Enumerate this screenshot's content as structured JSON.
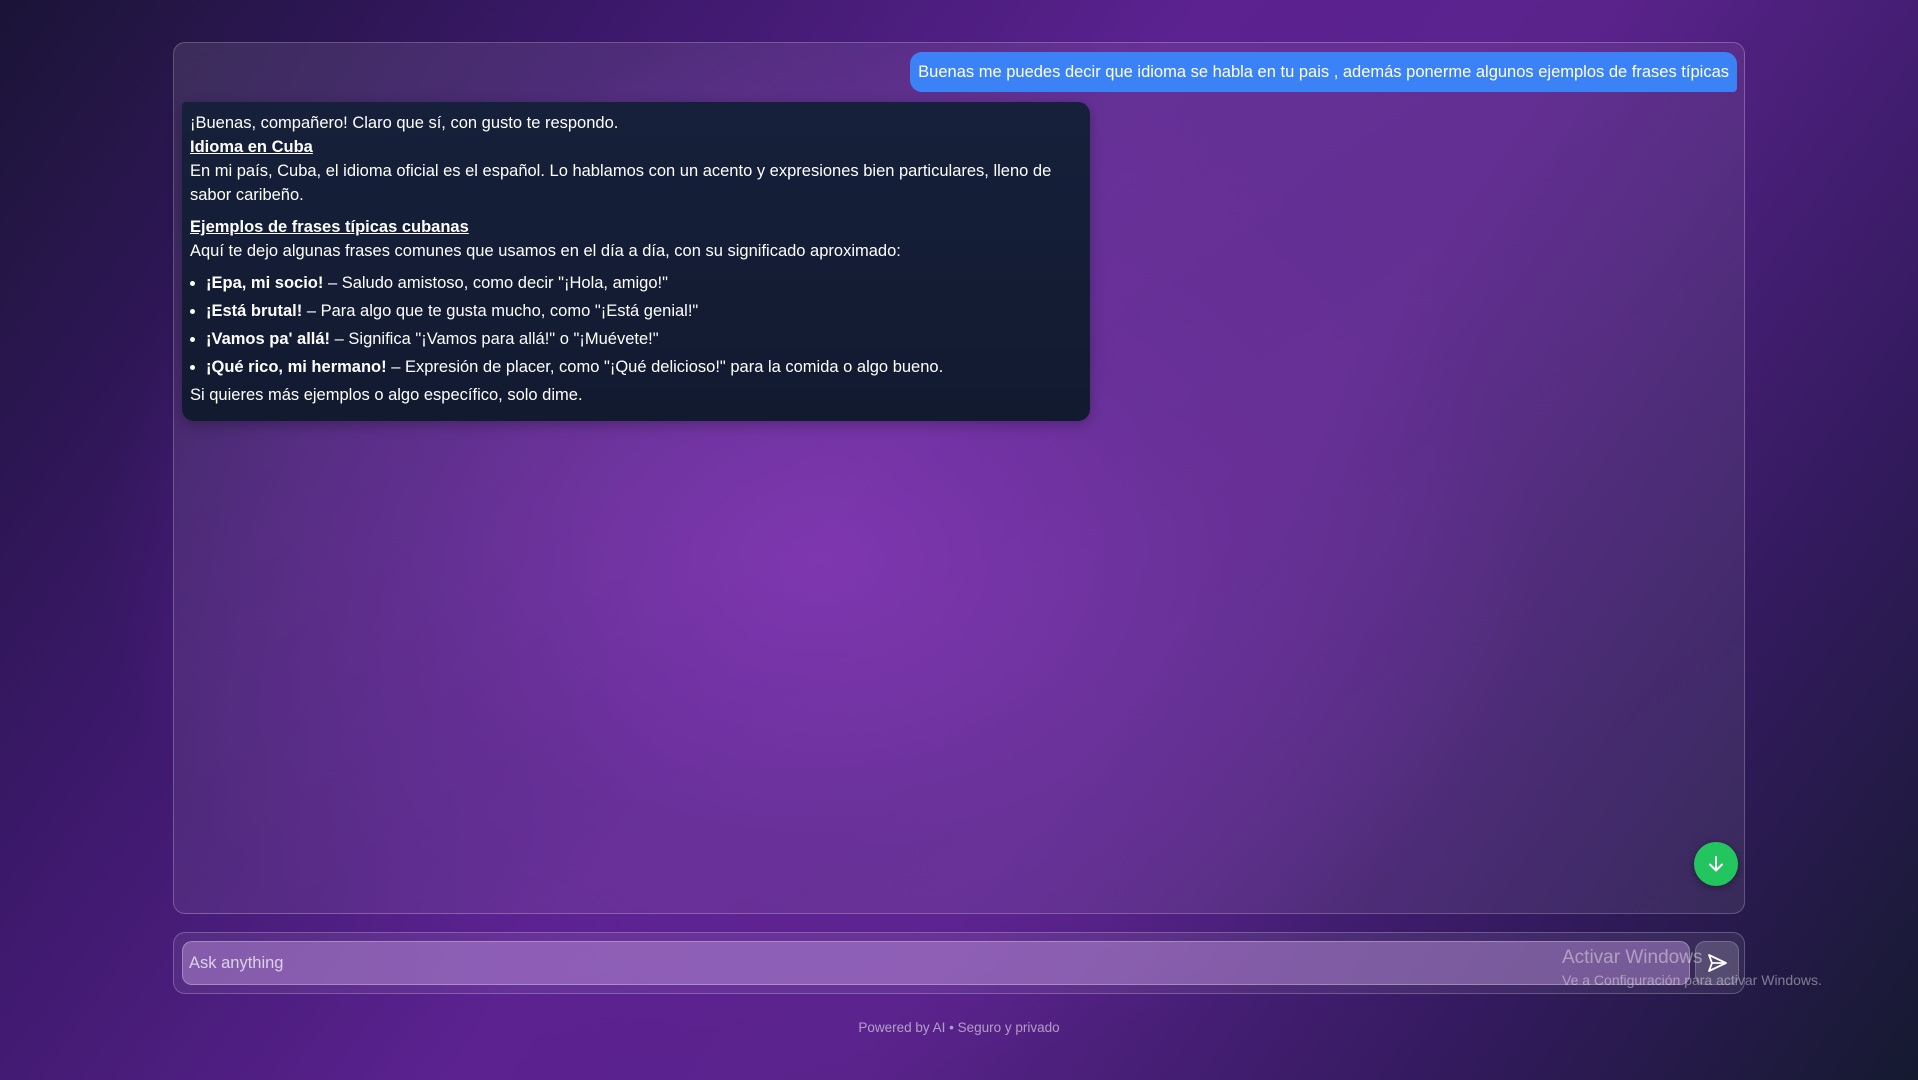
{
  "conversation": {
    "user_message": "Buenas me puedes decir que idioma se habla en tu pais , además ponerme algunos ejemplos de frases típicas",
    "assistant": {
      "greeting": "¡Buenas, compañero! Claro que sí, con gusto te respondo.",
      "heading_language": "Idioma en Cuba",
      "language_text": "En mi país, Cuba, el idioma oficial es el español. Lo hablamos con un acento y expresiones bien particulares, lleno de sabor caribeño.",
      "heading_phrases": "Ejemplos de frases típicas cubanas",
      "phrases_intro": "Aquí te dejo algunas frases comunes que usamos en el día a día, con su significado aproximado:",
      "phrases": [
        {
          "phrase": "¡Epa, mi socio!",
          "meaning": " – Saludo amistoso, como decir \"¡Hola, amigo!\""
        },
        {
          "phrase": "¡Está brutal!",
          "meaning": " – Para algo que te gusta mucho, como \"¡Está genial!\""
        },
        {
          "phrase": "¡Vamos pa' allá!",
          "meaning": " – Significa \"¡Vamos para allá!\" o \"¡Muévete!\""
        },
        {
          "phrase": "¡Qué rico, mi hermano!",
          "meaning": " – Expresión de placer, como \"¡Qué delicioso!\" para la comida o algo bueno."
        }
      ],
      "closing": "Si quieres más ejemplos o algo específico, solo dime."
    }
  },
  "composer": {
    "placeholder": "Ask anything",
    "value": ""
  },
  "icons": {
    "scroll_down": "arrow-down-icon",
    "send": "send-icon"
  },
  "footer": {
    "text": "Powered by AI • Seguro y privado"
  },
  "watermark": {
    "title": "Activar Windows",
    "subtitle": "Ve a Configuración para activar Windows."
  },
  "colors": {
    "user_bubble": "#3b82f6",
    "assistant_bubble": "#16203a",
    "scroll_button": "#22c55e"
  }
}
